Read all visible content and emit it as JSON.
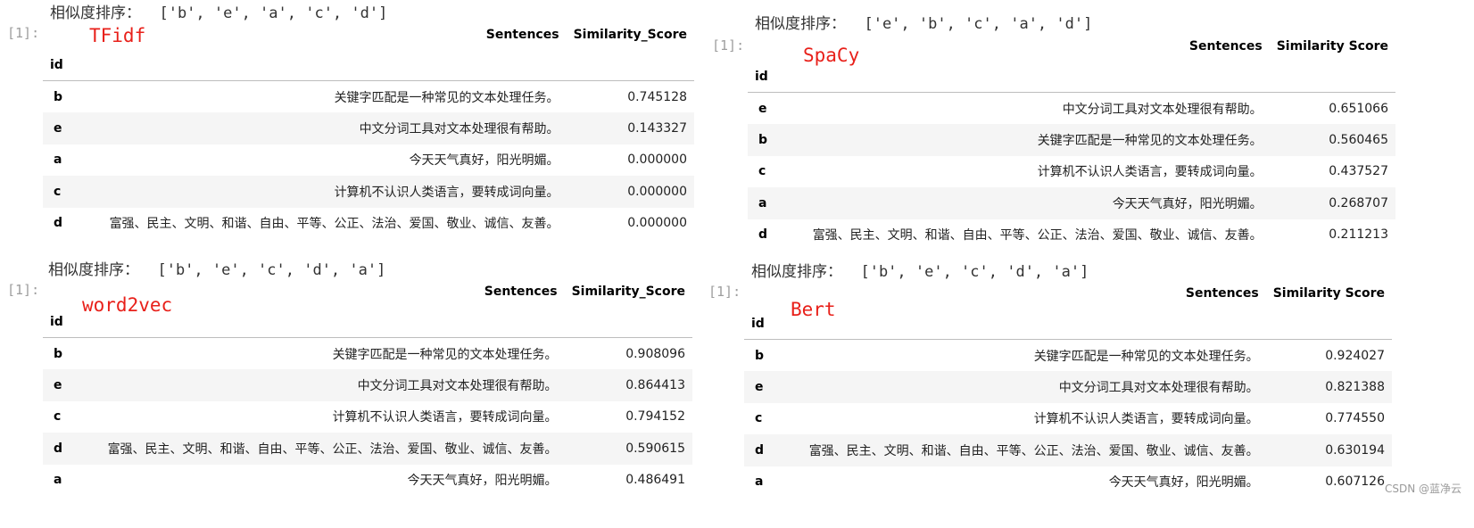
{
  "panels": [
    {
      "prompt": "[1]:",
      "print_line": "相似度排序：  ['b', 'e', 'a', 'c', 'd']",
      "annotation": "TFidf",
      "columns": [
        "Sentences",
        "Similarity_Score"
      ],
      "index_label": "id",
      "rows": [
        {
          "id": "b",
          "sentence": "关键字匹配是一种常见的文本处理任务。",
          "score": "0.745128"
        },
        {
          "id": "e",
          "sentence": "中文分词工具对文本处理很有帮助。",
          "score": "0.143327"
        },
        {
          "id": "a",
          "sentence": "今天天气真好，阳光明媚。",
          "score": "0.000000"
        },
        {
          "id": "c",
          "sentence": "计算机不认识人类语言，要转成词向量。",
          "score": "0.000000"
        },
        {
          "id": "d",
          "sentence": "富强、民主、文明、和谐、自由、平等、公正、法治、爱国、敬业、诚信、友善。",
          "score": "0.000000"
        }
      ]
    },
    {
      "prompt": "[1]:",
      "print_line": "相似度排序：  ['e', 'b', 'c', 'a', 'd']",
      "annotation": "SpaCy",
      "columns": [
        "Sentences",
        "Similarity Score"
      ],
      "index_label": "id",
      "rows": [
        {
          "id": "e",
          "sentence": "中文分词工具对文本处理很有帮助。",
          "score": "0.651066"
        },
        {
          "id": "b",
          "sentence": "关键字匹配是一种常见的文本处理任务。",
          "score": "0.560465"
        },
        {
          "id": "c",
          "sentence": "计算机不认识人类语言，要转成词向量。",
          "score": "0.437527"
        },
        {
          "id": "a",
          "sentence": "今天天气真好，阳光明媚。",
          "score": "0.268707"
        },
        {
          "id": "d",
          "sentence": "富强、民主、文明、和谐、自由、平等、公正、法治、爱国、敬业、诚信、友善。",
          "score": "0.211213"
        }
      ]
    },
    {
      "prompt": "[1]:",
      "print_line": "相似度排序：  ['b', 'e', 'c', 'd', 'a']",
      "annotation": "word2vec",
      "columns": [
        "Sentences",
        "Similarity_Score"
      ],
      "index_label": "id",
      "rows": [
        {
          "id": "b",
          "sentence": "关键字匹配是一种常见的文本处理任务。",
          "score": "0.908096"
        },
        {
          "id": "e",
          "sentence": "中文分词工具对文本处理很有帮助。",
          "score": "0.864413"
        },
        {
          "id": "c",
          "sentence": "计算机不认识人类语言，要转成词向量。",
          "score": "0.794152"
        },
        {
          "id": "d",
          "sentence": "富强、民主、文明、和谐、自由、平等、公正、法治、爱国、敬业、诚信、友善。",
          "score": "0.590615"
        },
        {
          "id": "a",
          "sentence": "今天天气真好，阳光明媚。",
          "score": "0.486491"
        }
      ]
    },
    {
      "prompt": "[1]:",
      "print_line": "相似度排序：  ['b', 'e', 'c', 'd', 'a']",
      "annotation": "Bert",
      "columns": [
        "Sentences",
        "Similarity Score"
      ],
      "index_label": "id",
      "rows": [
        {
          "id": "b",
          "sentence": "关键字匹配是一种常见的文本处理任务。",
          "score": "0.924027"
        },
        {
          "id": "e",
          "sentence": "中文分词工具对文本处理很有帮助。",
          "score": "0.821388"
        },
        {
          "id": "c",
          "sentence": "计算机不认识人类语言，要转成词向量。",
          "score": "0.774550"
        },
        {
          "id": "d",
          "sentence": "富强、民主、文明、和谐、自由、平等、公正、法治、爱国、敬业、诚信、友善。",
          "score": "0.630194"
        },
        {
          "id": "a",
          "sentence": "今天天气真好，阳光明媚。",
          "score": "0.607126"
        }
      ]
    }
  ],
  "watermark": "CSDN @蓝净云"
}
